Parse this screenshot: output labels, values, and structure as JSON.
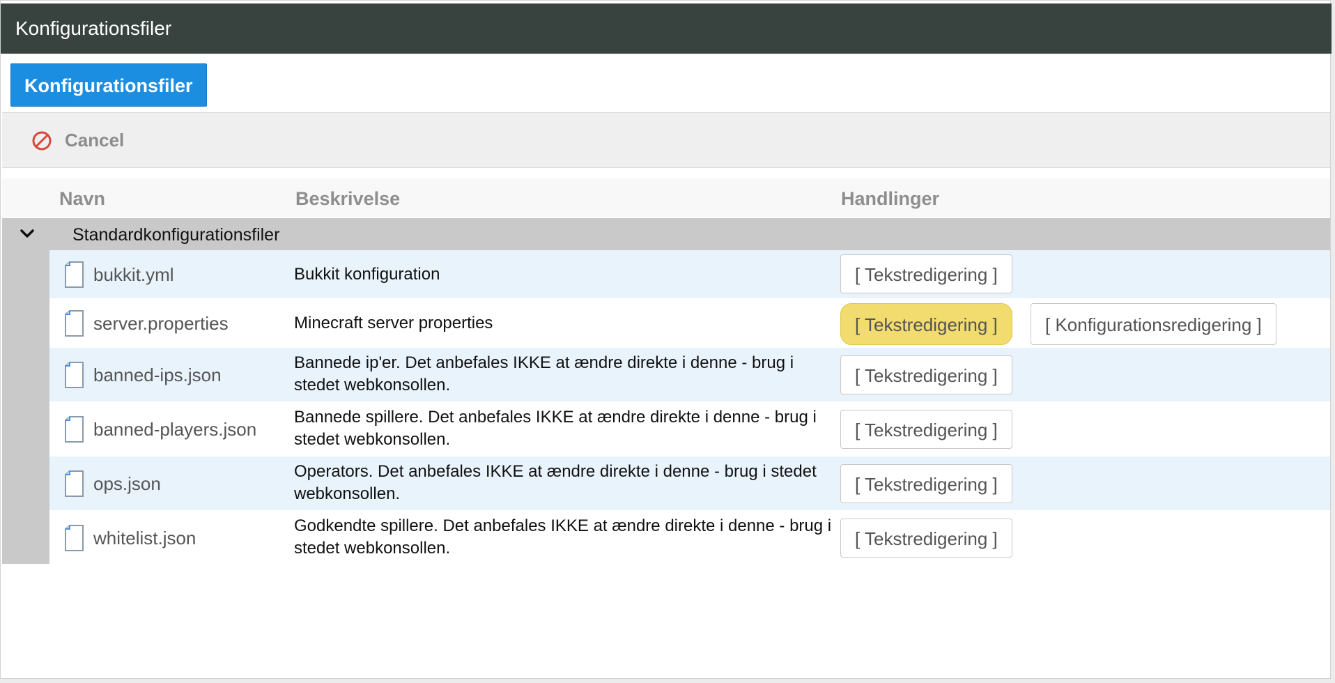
{
  "window": {
    "title": "Konfigurationsfiler"
  },
  "tab": {
    "label": "Konfigurationsfiler"
  },
  "toolbar": {
    "cancel_label": "Cancel"
  },
  "table": {
    "headers": {
      "name": "Navn",
      "description": "Beskrivelse",
      "actions": "Handlinger"
    },
    "group": {
      "title": "Standardkonfigurationsfiler"
    },
    "rows": [
      {
        "name": "bukkit.yml",
        "description": "Bukkit konfiguration",
        "text_edit": "[ Tekstredigering ]"
      },
      {
        "name": "server.properties",
        "description": "Minecraft server properties",
        "text_edit": "[ Tekstredigering ]",
        "config_edit": "[ Konfigurationsredigering ]"
      },
      {
        "name": "banned-ips.json",
        "description": "Bannede ip'er. Det anbefales IKKE at ændre direkte i denne - brug i stedet webkonsollen.",
        "text_edit": "[ Tekstredigering ]"
      },
      {
        "name": "banned-players.json",
        "description": "Bannede spillere. Det anbefales IKKE at ændre direkte i denne - brug i stedet webkonsollen.",
        "text_edit": "[ Tekstredigering ]"
      },
      {
        "name": "ops.json",
        "description": "Operators. Det anbefales IKKE at ændre direkte i denne - brug i stedet webkonsollen.",
        "text_edit": "[ Tekstredigering ]"
      },
      {
        "name": "whitelist.json",
        "description": "Godkendte spillere. Det anbefales IKKE at ændre direkte i denne - brug i stedet webkonsollen.",
        "text_edit": "[ Tekstredigering ]"
      }
    ]
  },
  "icons": {
    "cancel": "prohibited-icon",
    "collapse": "chevron-down-icon",
    "file": "file-icon"
  },
  "colors": {
    "titlebar": "#38423f",
    "primary": "#1c8ee2",
    "highlight": "#f2db6f",
    "row_alt": "#e9f3fc",
    "group": "#c9c9c9",
    "cancel_icon": "#d9473a"
  }
}
